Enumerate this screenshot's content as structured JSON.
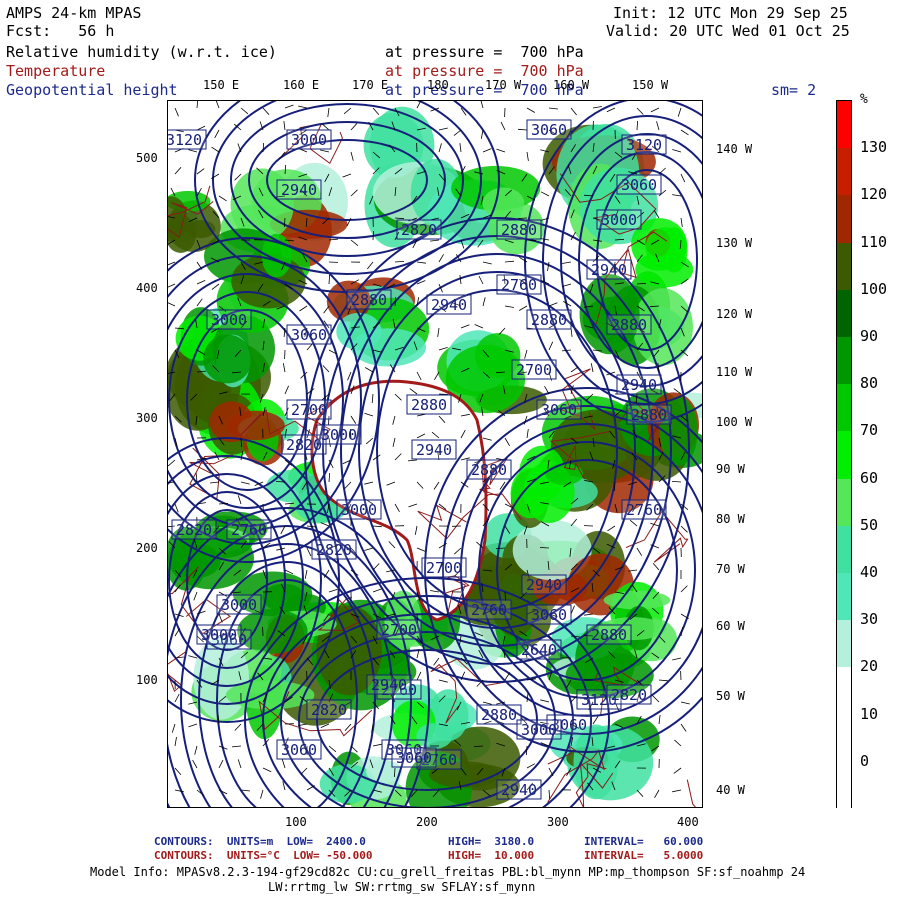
{
  "header": {
    "model": "AMPS 24-km MPAS",
    "forecast": "Fcst:   56 h",
    "init": "Init: 12 UTC Mon 29 Sep 25",
    "valid": "Valid: 20 UTC Wed 01 Oct 25",
    "fields": [
      {
        "name": "Relative humidity (w.r.t. ice)",
        "level": "at pressure =  700 hPa",
        "color": "#000000"
      },
      {
        "name": "Temperature",
        "level": "at pressure =  700 hPa",
        "color": "#a31a1a"
      },
      {
        "name": "Geopotential height",
        "level": "at pressure =  700 hPa",
        "color": "#1c2a8c"
      }
    ],
    "smoothing": "sm= 2"
  },
  "top_lon_labels": [
    "150 E",
    "160 E",
    "170 E",
    "180",
    "170 W",
    "160 W",
    "150 W"
  ],
  "right_lon_labels": [
    "140 W",
    "130 W",
    "120 W",
    "110 W",
    "100 W",
    "90 W",
    "80 W",
    "70 W",
    "60 W",
    "50 W",
    "40 W"
  ],
  "y_axis_labels": [
    "500",
    "400",
    "300",
    "200",
    "100"
  ],
  "x_axis_labels": [
    "100",
    "200",
    "300",
    "400"
  ],
  "legend": {
    "unit": "%",
    "labels": [
      "130",
      "120",
      "110",
      "100",
      "90",
      "80",
      "70",
      "60",
      "50",
      "40",
      "30",
      "20",
      "10",
      "0"
    ],
    "colors": [
      "#ff0000",
      "#c81e00",
      "#a02800",
      "#3c5a00",
      "#006400",
      "#009600",
      "#00c800",
      "#00ee00",
      "#55e65a",
      "#40e0a0",
      "#50e6b8",
      "#b4f0dc",
      "#ffffff",
      "#ffffff",
      "#ffffff"
    ]
  },
  "height_contour_labels": [
    "3120",
    "3000",
    "3060",
    "3120",
    "2940",
    "3060",
    "3000",
    "2820",
    "2880",
    "2940",
    "2880",
    "2760",
    "3060",
    "2940",
    "2880",
    "2700",
    "2880",
    "3000",
    "2940",
    "2700",
    "2880",
    "3060",
    "2820",
    "3000",
    "2880",
    "2940",
    "2820",
    "2760",
    "3000",
    "2880",
    "2760",
    "2700",
    "2820",
    "2760",
    "2700",
    "3000",
    "3060",
    "2940",
    "2880",
    "2640",
    "2760",
    "3060",
    "2820",
    "2940",
    "3120",
    "2880",
    "2820",
    "3060",
    "3060",
    "2760",
    "3000",
    "3000",
    "3060",
    "2940",
    "3060"
  ],
  "footer": {
    "line1": {
      "prefix": "CONTOURS:  UNITS=m  LOW=  2400.0",
      "high": "HIGH=  3180.0",
      "interval": "INTERVAL=   60.000"
    },
    "line2": {
      "prefix": "CONTOURS:  UNITS=°C  LOW= -50.000",
      "high": "HIGH=  10.000",
      "interval": "INTERVAL=   5.0000"
    },
    "model_info": "Model Info: MPASv8.2.3-194-gf29cd82c CU:cu_grell_freitas PBL:bl_mynn MP:mp_thompson SF:sf_noahmp 24",
    "model_info2": "LW:rrtmg_lw SW:rrtmg_sw SFLAY:sf_mynn"
  }
}
